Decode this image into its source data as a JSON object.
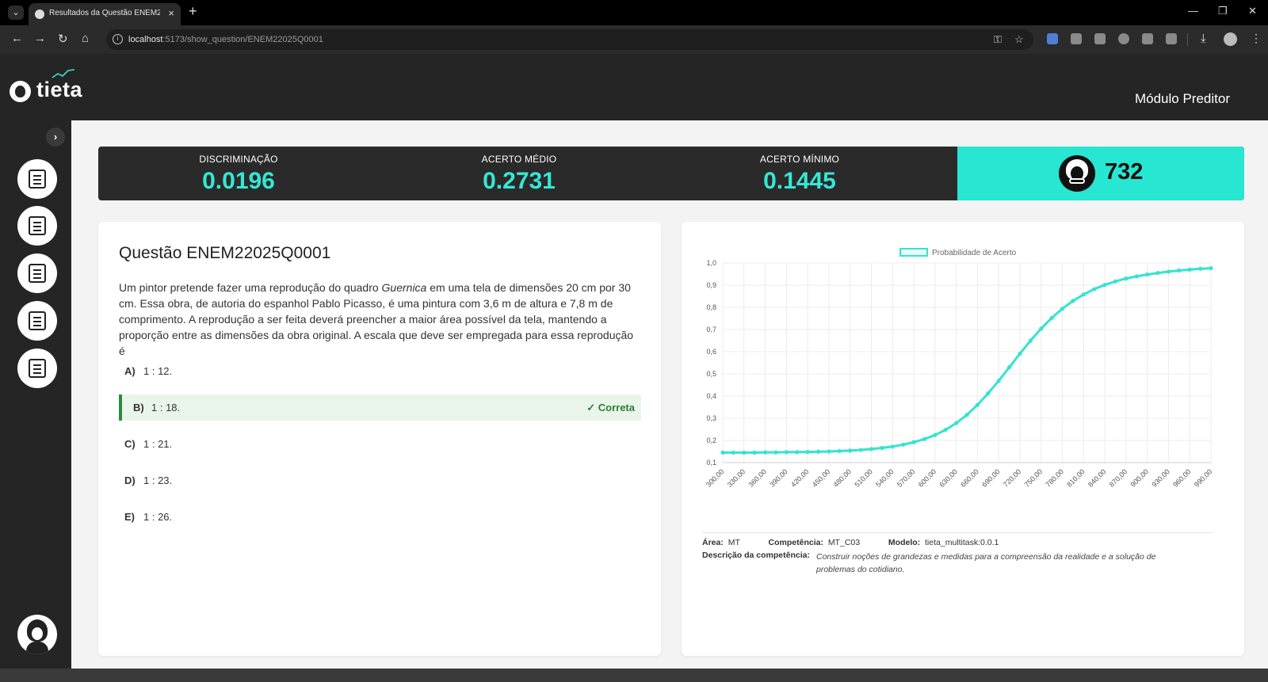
{
  "browser": {
    "tab_title": "Resultados da Questão ENEM2",
    "url_host": "localhost",
    "url_path": ":5173/show_question/ENEM22025Q0001"
  },
  "app": {
    "logo_text": "tieta",
    "module_title": "Módulo Preditor"
  },
  "sidebar": {
    "items": [
      {
        "name": "sidebar-item-students",
        "icon": "students-icon"
      },
      {
        "name": "sidebar-item-files",
        "icon": "folder-icon"
      },
      {
        "name": "sidebar-item-edit",
        "icon": "document-edit-icon"
      },
      {
        "name": "sidebar-item-teacher",
        "icon": "teacher-laptop-icon"
      },
      {
        "name": "sidebar-item-reports",
        "icon": "report-chart-icon"
      }
    ]
  },
  "stats": {
    "discriminacao_label": "DISCRIMINAÇÃO",
    "discriminacao_value": "0.0196",
    "acerto_medio_label": "ACERTO MÉDIO",
    "acerto_medio_value": "0.2731",
    "acerto_minimo_label": "ACERTO MÍNIMO",
    "acerto_minimo_value": "0.1445",
    "score": "732"
  },
  "question": {
    "title": "Questão ENEM22025Q0001",
    "text_before": "Um pintor pretende fazer uma reprodução do quadro ",
    "text_em": "Guernica",
    "text_after": " em uma tela de dimensões 20 cm por 30 cm. Essa obra, de autoria do espanhol Pablo Picasso, é uma pintura com 3,6 m de altura e 7,8 m de comprimento. A reprodução a ser feita deverá preencher a maior área possível da tela, mantendo a proporção entre as dimensões da obra original. A escala que deve ser empregada para essa reprodução é",
    "options": [
      {
        "letter": "A)",
        "text": "1 : 12."
      },
      {
        "letter": "B)",
        "text": "1 : 18."
      },
      {
        "letter": "C)",
        "text": "1 : 21."
      },
      {
        "letter": "D)",
        "text": "1 : 23."
      },
      {
        "letter": "E)",
        "text": "1 : 26."
      }
    ],
    "correct_label": "✓ Correta"
  },
  "meta": {
    "area_label": "Área:",
    "area_value": "MT",
    "competencia_label": "Competência:",
    "competencia_value": "MT_C03",
    "modelo_label": "Modelo:",
    "modelo_value": "tieta_multitask:0.0.1",
    "descricao_label": "Descrição da competência:",
    "descricao_value": "Construir noções de grandezas e medidas para a compreensão da realidade e a solução de problemas do cotidiano."
  },
  "chart_data": {
    "type": "line",
    "legend": "Probabilidade de Acerto",
    "legend_position": "top",
    "color": "#35e3d0",
    "grid": true,
    "ylim": [
      0.1,
      1.0
    ],
    "y_ticks": [
      "1,0",
      "0,9",
      "0,8",
      "0,7",
      "0,6",
      "0,5",
      "0,4",
      "0,3",
      "0,2",
      "0,1"
    ],
    "x_ticks": [
      "300,00",
      "330,00",
      "360,00",
      "390,00",
      "420,00",
      "450,00",
      "480,00",
      "510,00",
      "540,00",
      "570,00",
      "600,00",
      "630,00",
      "660,00",
      "690,00",
      "720,00",
      "750,00",
      "780,00",
      "810,00",
      "840,00",
      "870,00",
      "900,00",
      "930,00",
      "960,00",
      "990,00"
    ],
    "x": [
      300,
      315,
      330,
      345,
      360,
      375,
      390,
      405,
      420,
      435,
      450,
      465,
      480,
      495,
      510,
      525,
      540,
      555,
      570,
      585,
      600,
      615,
      630,
      645,
      660,
      675,
      690,
      705,
      720,
      735,
      750,
      765,
      780,
      795,
      810,
      825,
      840,
      855,
      870,
      885,
      900,
      915,
      930,
      945,
      960,
      975,
      990
    ],
    "y": [
      0.145,
      0.145,
      0.145,
      0.145,
      0.146,
      0.146,
      0.147,
      0.147,
      0.148,
      0.149,
      0.15,
      0.152,
      0.154,
      0.157,
      0.161,
      0.166,
      0.172,
      0.181,
      0.192,
      0.206,
      0.224,
      0.248,
      0.278,
      0.315,
      0.36,
      0.412,
      0.469,
      0.53,
      0.591,
      0.65,
      0.704,
      0.752,
      0.794,
      0.829,
      0.858,
      0.882,
      0.901,
      0.917,
      0.93,
      0.94,
      0.948,
      0.955,
      0.961,
      0.966,
      0.97,
      0.974,
      0.976
    ]
  }
}
